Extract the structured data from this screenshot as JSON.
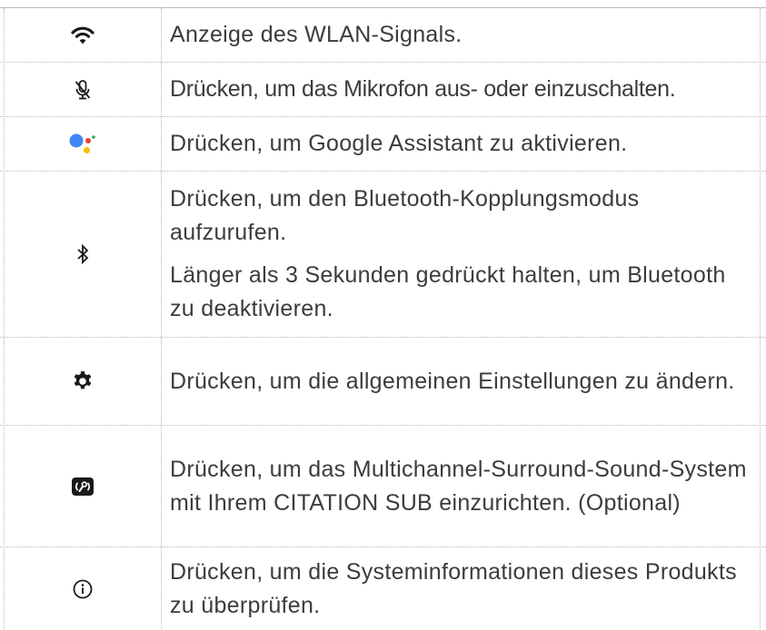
{
  "rows": [
    {
      "icon": "wifi-icon",
      "texts": [
        "Anzeige des WLAN-Signals."
      ]
    },
    {
      "icon": "microphone-muted-icon",
      "texts": [
        "Drücken, um das Mikrofon aus- oder einzuschalten."
      ]
    },
    {
      "icon": "google-assistant-icon",
      "texts": [
        "Drücken, um Google Assistant zu aktivieren."
      ]
    },
    {
      "icon": "bluetooth-icon",
      "texts": [
        "Drücken, um den Bluetooth-Kopplungsmodus aufzurufen.",
        "Länger als 3 Sekunden gedrückt halten, um Bluetooth zu deaktivieren."
      ]
    },
    {
      "icon": "gear-icon",
      "texts": [
        "Drücken, um die allgemeinen Einstellungen zu ändern."
      ]
    },
    {
      "icon": "surround-setup-icon",
      "texts": [
        "Drücken, um das Multichannel-Surround-Sound-System mit Ihrem CITATION SUB einzurichten. (Optional)"
      ]
    },
    {
      "icon": "info-icon",
      "texts": [
        "Drücken, um die Systeminformationen dieses Produkts zu überprüfen."
      ]
    }
  ],
  "colors": {
    "text": "#3c3c3c",
    "border": "#b8b8b8",
    "google_blue": "#4285F4",
    "google_red": "#EA4335",
    "google_yellow": "#FBBC05",
    "google_green": "#34A853"
  }
}
